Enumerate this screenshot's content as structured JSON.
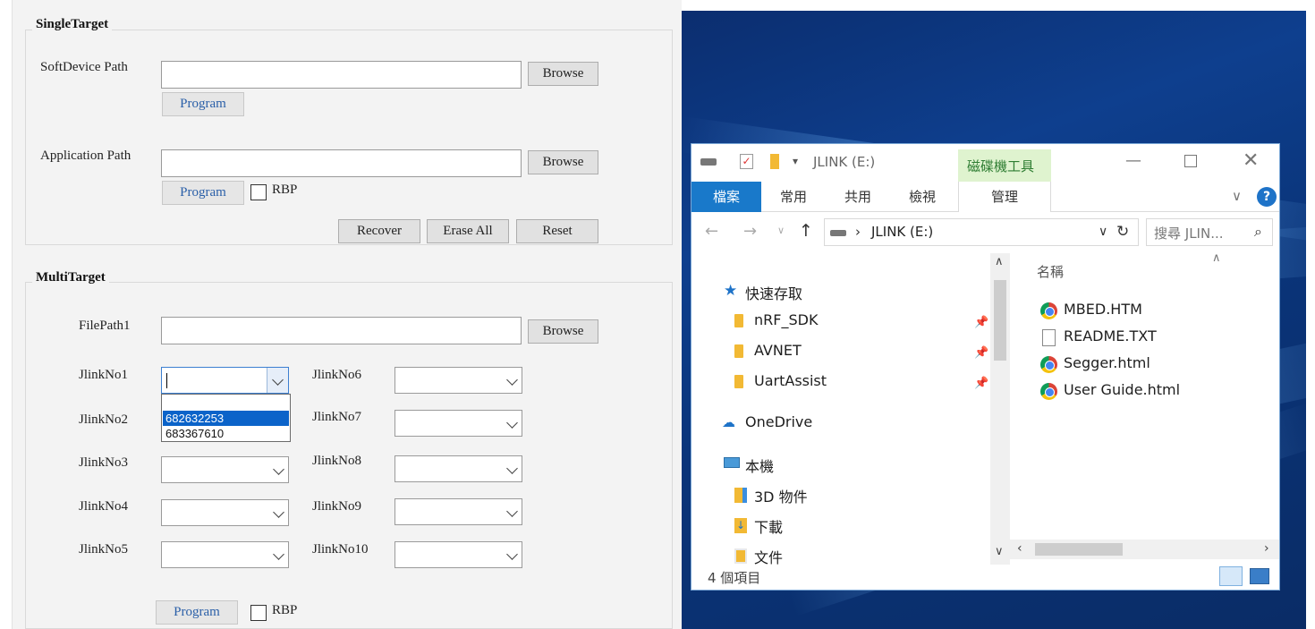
{
  "left_app": {
    "single_target": {
      "title": "SingleTarget",
      "softdevice_label": "SoftDevice Path",
      "application_label": "Application Path",
      "browse_label": "Browse",
      "program_label": "Program",
      "rbp_label": "RBP",
      "recover_label": "Recover",
      "erase_all_label": "Erase All",
      "reset_label": "Reset"
    },
    "multi_target": {
      "title": "MultiTarget",
      "filepath_label": "FilePath1",
      "browse_label": "Browse",
      "jlink_labels": [
        "JlinkNo1",
        "JlinkNo2",
        "JlinkNo3",
        "JlinkNo4",
        "JlinkNo5",
        "JlinkNo6",
        "JlinkNo7",
        "JlinkNo8",
        "JlinkNo9",
        "JlinkNo10"
      ],
      "dropdown_options": [
        "",
        "682632253",
        "683367610"
      ],
      "dropdown_selected": "682632253",
      "program_label": "Program",
      "rbp_label": "RBP"
    }
  },
  "explorer": {
    "title": "JLINK (E:)",
    "context_tab": "磁碟機工具",
    "tabs": [
      "檔案",
      "常用",
      "共用",
      "檢視",
      "管理"
    ],
    "address": "JLINK (E:)",
    "search_placeholder": "搜尋 JLIN...",
    "nav": {
      "quick_access": "快速存取",
      "pinned": [
        "nRF_SDK",
        "AVNET",
        "UartAssist"
      ],
      "onedrive": "OneDrive",
      "this_pc": "本機",
      "pc_items": [
        "3D 物件",
        "下載",
        "文件"
      ]
    },
    "column_name": "名稱",
    "files": [
      {
        "name": "MBED.HTM",
        "icon": "chrome-icon"
      },
      {
        "name": "README.TXT",
        "icon": "text-file-icon"
      },
      {
        "name": "Segger.html",
        "icon": "chrome-icon"
      },
      {
        "name": "User Guide.html",
        "icon": "chrome-icon"
      }
    ],
    "status": "4 個項目"
  }
}
